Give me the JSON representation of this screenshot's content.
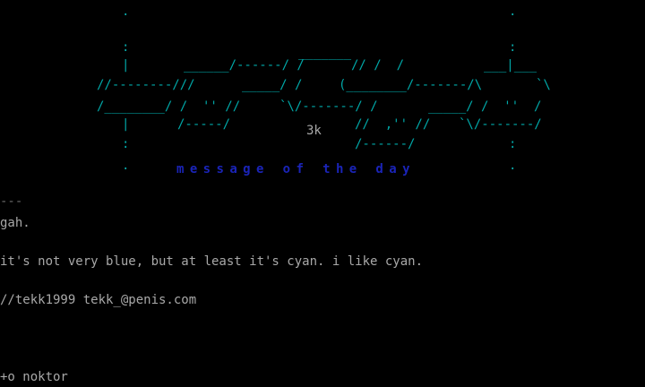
{
  "ascii_art": {
    "lines": [
      "                  .                                                            .",
      "",
      "                  :                                                            :",
      "                  :                              _______                        :",
      "                  |       ______/------/ /    // /  /                    ___|___",
      "               //---------/// :   _____/ /     (________/-------/\\     /`  \\",
      "               /_________/ /  '' //     `\\/-------/ /       _____/ /  ''  /",
      "                  |     /-----/             //  ,''  //   `\\/-------/",
      "                  :                              /------/                        :",
      "                  .                                                            ."
    ],
    "tag": "3k",
    "subtitle": "message of the day"
  },
  "message": {
    "separator": "---",
    "line1": "gah.",
    "line2": "it's not very blue, but at least it's cyan. i like cyan.",
    "line3": "//tekk1999 tekk_@penis.com",
    "line4": "+o noktor"
  },
  "colors": {
    "background": "#000000",
    "text": "#a8a8a8",
    "art": "#00a8a8",
    "subtitle": "#1a24b8"
  }
}
